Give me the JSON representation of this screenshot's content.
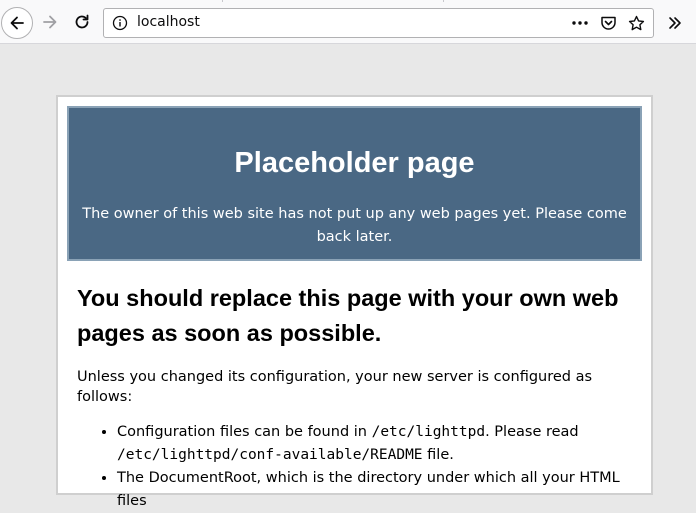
{
  "browser": {
    "url": "localhost",
    "icons": {
      "back": "back-arrow-icon",
      "forward": "forward-arrow-icon",
      "reload": "reload-icon",
      "info": "site-info-icon",
      "page_actions": "more-horizontal-icon",
      "pocket": "pocket-icon",
      "bookmark": "bookmark-star-icon",
      "overflow": "chevron-double-right-icon"
    }
  },
  "banner": {
    "title": "Placeholder page",
    "subtitle": "The owner of this web site has not put up any web pages yet. Please come back later."
  },
  "content": {
    "heading": "You should replace this page with your own web pages as soon as possible.",
    "intro": "Unless you changed its configuration, your new server is configured as follows:",
    "items": [
      {
        "text_before": "Configuration files can be found in ",
        "code1": "/etc/lighttpd",
        "text_middle": ". Please read ",
        "code2": "/etc/lighttpd/conf-available/README",
        "text_after": " file."
      },
      {
        "text": "The DocumentRoot, which is the directory under which all your HTML files"
      }
    ]
  },
  "colors": {
    "banner_bg": "#4a6884",
    "page_bg": "#e8e8e8"
  }
}
